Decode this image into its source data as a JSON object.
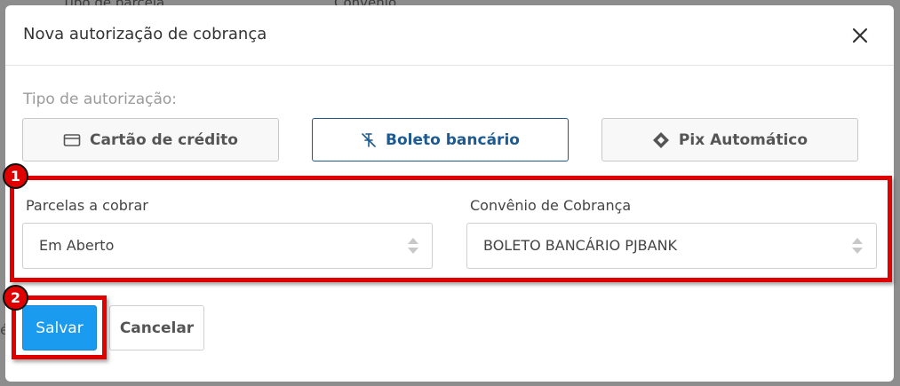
{
  "backdrop": {
    "col1": "Tipo de parcela",
    "col2": "Convênio",
    "left_glyph": "é"
  },
  "modal": {
    "title": "Nova autorização de cobrança",
    "close_icon": "close-icon"
  },
  "authorization": {
    "label": "Tipo de autorização:",
    "options": [
      {
        "label": "Cartão de crédito",
        "icon": "credit-card-icon",
        "active": false
      },
      {
        "label": "Boleto bancário",
        "icon": "pin-off-icon",
        "active": true
      },
      {
        "label": "Pix Automático",
        "icon": "pix-icon",
        "active": false
      }
    ]
  },
  "fields": {
    "parcelas": {
      "label": "Parcelas a cobrar",
      "value": "Em Aberto"
    },
    "convenio": {
      "label": "Convênio de Cobrança",
      "value": "BOLETO BANCÁRIO PJBANK"
    }
  },
  "actions": {
    "save_label": "Salvar",
    "cancel_label": "Cancelar"
  },
  "annotations": {
    "step1": "1",
    "step2": "2"
  },
  "colors": {
    "primary": "#1a9bef",
    "active_border": "#1c5a91",
    "highlight": "#e00000"
  }
}
